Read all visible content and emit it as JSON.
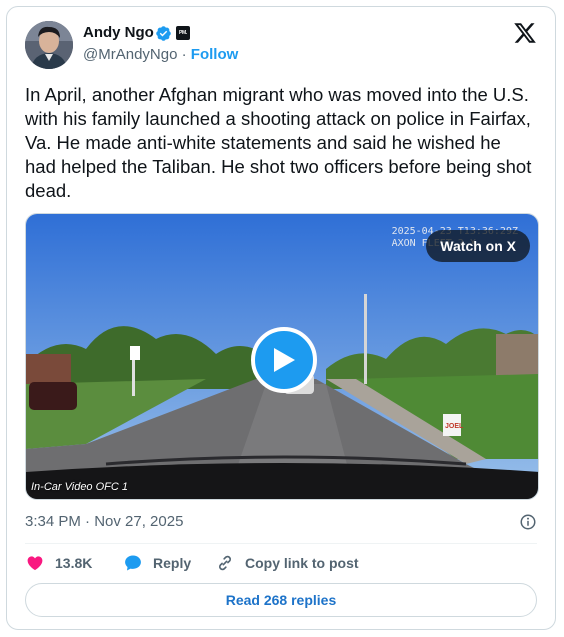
{
  "author": {
    "name": "Andy Ngo",
    "handle": "@MrAndyNgo",
    "separator": "·",
    "follow_label": "Follow",
    "affiliation_badge": "PM.",
    "verified_color": "#1d9bf0"
  },
  "tweet": {
    "text": "In April, another Afghan migrant who was moved into the U.S. with his family launched a shooting attack on police in Fairfax, Va. He made anti-white statements and said he wished he had helped the Taliban. He shot two officers before being shot dead."
  },
  "media": {
    "overlay_timestamp_line1": "2025-04-23 T13:36:29Z",
    "overlay_timestamp_line2": "AXON FLEET 2 X",
    "watch_label": "Watch on X",
    "caption": "In-Car Video OFC 1",
    "play_button_color": "#1d9bf0",
    "road_sign": "JOEL"
  },
  "meta": {
    "timestamp": "3:34 PM · Nov 27, 2025"
  },
  "actions": {
    "like_count": "13.8K",
    "reply_label": "Reply",
    "copy_link_label": "Copy link to post",
    "like_color": "#f91880",
    "reply_color": "#1d9bf0"
  },
  "footer": {
    "read_replies_label": "Read 268 replies"
  },
  "icons": [
    "verified-badge-icon",
    "x-logo-icon",
    "play-icon",
    "info-icon",
    "heart-icon",
    "reply-icon",
    "link-icon"
  ]
}
